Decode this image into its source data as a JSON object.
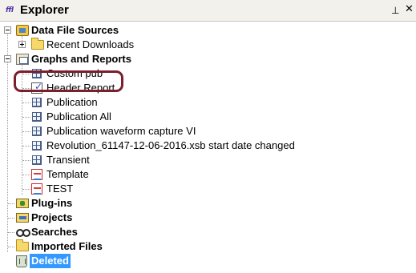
{
  "panel": {
    "title": "Explorer",
    "title_icon_text": "ffl",
    "pin_glyph": "⊥",
    "close_glyph": "✕"
  },
  "tree": {
    "data_file_sources": {
      "label": "Data File Sources",
      "icon": "data-source-icon",
      "expanded": true
    },
    "recent_downloads": {
      "label": "Recent Downloads",
      "icon": "folder-icon",
      "expanded": false
    },
    "graphs_and_reports": {
      "label": "Graphs and Reports",
      "icon": "graphs-reports-icon",
      "expanded": true
    },
    "reports": [
      {
        "label": "Custom pub",
        "icon": "report-grid-icon"
      },
      {
        "label": "Header Report",
        "icon": "header-report-icon"
      },
      {
        "label": "Publication",
        "icon": "report-grid-icon"
      },
      {
        "label": "Publication All",
        "icon": "report-grid-icon"
      },
      {
        "label": "Publication waveform capture VI",
        "icon": "report-grid-icon"
      },
      {
        "label": "Revolution_61147-12-06-2016.xsb start date changed",
        "icon": "report-grid-icon"
      },
      {
        "label": "Transient",
        "icon": "report-grid-icon"
      },
      {
        "label": "Template",
        "icon": "template-icon"
      },
      {
        "label": "TEST",
        "icon": "template-icon"
      }
    ],
    "plug_ins": {
      "label": "Plug-ins",
      "icon": "plugins-icon"
    },
    "projects": {
      "label": "Projects",
      "icon": "projects-icon"
    },
    "searches": {
      "label": "Searches",
      "icon": "binoculars-icon"
    },
    "imported_files": {
      "label": "Imported Files",
      "icon": "folder-icon"
    },
    "deleted": {
      "label": "Deleted",
      "icon": "recycle-bin-icon",
      "selected": true
    }
  },
  "colors": {
    "selection": "#3399ff",
    "highlight_outline": "#7a1f2b"
  }
}
